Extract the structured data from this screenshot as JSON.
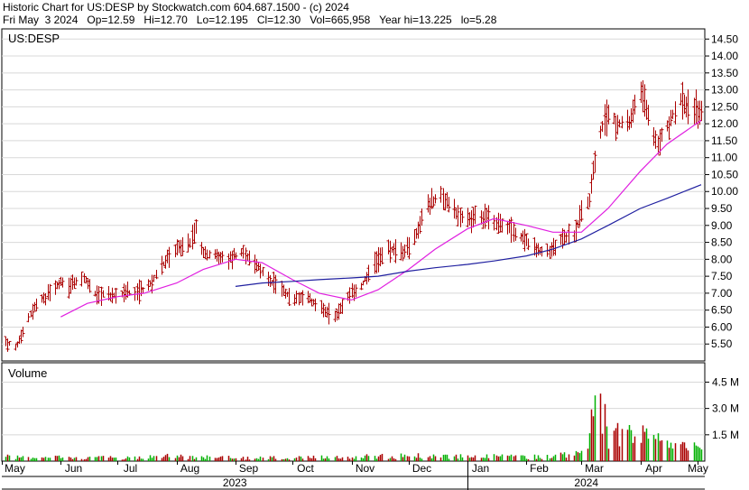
{
  "header": {
    "line1": "Historic Chart for US:DESP by Stockwatch.com 604.687.1500 - (c) 2024",
    "line2": "Fri May  3 2024   Op=12.59   Hi=12.70   Lo=12.195   Cl=12.30   Vol=665,958   Year hi=13.225   lo=5.28"
  },
  "chart_data": {
    "type": "ohlc-bar",
    "symbol": "US:DESP",
    "price_axis": {
      "min": 5.0,
      "max": 14.8,
      "ticks": [
        "5.50",
        "6.00",
        "6.50",
        "7.00",
        "7.50",
        "8.00",
        "8.50",
        "9.00",
        "9.50",
        "10.00",
        "10.50",
        "11.00",
        "11.50",
        "12.00",
        "12.50",
        "13.00",
        "13.50",
        "14.00",
        "14.50"
      ]
    },
    "volume_panel": {
      "label": "Volume",
      "max_m": 5.5,
      "ticks": [
        "1.5 M",
        "3.0 M",
        "4.5 M"
      ]
    },
    "months": [
      "May",
      "Jun",
      "Jul",
      "Aug",
      "Sep",
      "Oct",
      "Nov",
      "Dec",
      "Jan",
      "Feb",
      "Mar",
      "Apr",
      "May"
    ],
    "years": [
      "2023",
      "2024"
    ],
    "price_anchors": [
      [
        "2023-05-03",
        5.6
      ],
      [
        "2023-05-08",
        5.4
      ],
      [
        "2023-05-12",
        5.9
      ],
      [
        "2023-05-18",
        6.6
      ],
      [
        "2023-05-24",
        6.9
      ],
      [
        "2023-06-01",
        7.3
      ],
      [
        "2023-06-06",
        7.2
      ],
      [
        "2023-06-12",
        7.5
      ],
      [
        "2023-06-19",
        7.0
      ],
      [
        "2023-06-26",
        6.9
      ],
      [
        "2023-07-03",
        7.0
      ],
      [
        "2023-07-10",
        7.0
      ],
      [
        "2023-07-17",
        7.2
      ],
      [
        "2023-07-24",
        7.8
      ],
      [
        "2023-07-31",
        8.3
      ],
      [
        "2023-08-07",
        8.4
      ],
      [
        "2023-08-11",
        8.9
      ],
      [
        "2023-08-15",
        8.2
      ],
      [
        "2023-08-21",
        8.1
      ],
      [
        "2023-08-28",
        8.0
      ],
      [
        "2023-09-05",
        8.2
      ],
      [
        "2023-09-11",
        7.9
      ],
      [
        "2023-09-18",
        7.4
      ],
      [
        "2023-09-25",
        7.1
      ],
      [
        "2023-10-02",
        6.8
      ],
      [
        "2023-10-09",
        6.9
      ],
      [
        "2023-10-16",
        6.5
      ],
      [
        "2023-10-23",
        6.3
      ],
      [
        "2023-10-30",
        6.9
      ],
      [
        "2023-11-06",
        7.2
      ],
      [
        "2023-11-13",
        7.9
      ],
      [
        "2023-11-20",
        8.3
      ],
      [
        "2023-11-27",
        8.2
      ],
      [
        "2023-12-04",
        8.6
      ],
      [
        "2023-12-11",
        9.6
      ],
      [
        "2023-12-18",
        9.9
      ],
      [
        "2023-12-25",
        9.4
      ],
      [
        "2024-01-02",
        9.2
      ],
      [
        "2024-01-08",
        9.3
      ],
      [
        "2024-01-15",
        9.1
      ],
      [
        "2024-01-22",
        9.0
      ],
      [
        "2024-01-29",
        8.7
      ],
      [
        "2024-02-05",
        8.3
      ],
      [
        "2024-02-12",
        8.2
      ],
      [
        "2024-02-19",
        8.6
      ],
      [
        "2024-02-26",
        8.7
      ],
      [
        "2024-03-01",
        9.4
      ],
      [
        "2024-03-05",
        9.8
      ],
      [
        "2024-03-08",
        11.0
      ],
      [
        "2024-03-11",
        11.8
      ],
      [
        "2024-03-15",
        12.3
      ],
      [
        "2024-03-20",
        12.0
      ],
      [
        "2024-03-26",
        12.1
      ],
      [
        "2024-04-01",
        12.9
      ],
      [
        "2024-04-05",
        12.2
      ],
      [
        "2024-04-10",
        11.4
      ],
      [
        "2024-04-16",
        12.0
      ],
      [
        "2024-04-22",
        12.7
      ],
      [
        "2024-04-26",
        12.5
      ],
      [
        "2024-05-03",
        12.3
      ]
    ],
    "sma_short": [
      [
        "2023-06-01",
        6.3
      ],
      [
        "2023-06-15",
        6.7
      ],
      [
        "2023-07-01",
        6.9
      ],
      [
        "2023-07-15",
        7.0
      ],
      [
        "2023-08-01",
        7.3
      ],
      [
        "2023-08-15",
        7.7
      ],
      [
        "2023-09-01",
        8.0
      ],
      [
        "2023-09-15",
        7.9
      ],
      [
        "2023-10-01",
        7.4
      ],
      [
        "2023-10-15",
        7.0
      ],
      [
        "2023-11-01",
        6.8
      ],
      [
        "2023-11-15",
        7.1
      ],
      [
        "2023-12-01",
        7.7
      ],
      [
        "2023-12-15",
        8.3
      ],
      [
        "2024-01-01",
        8.9
      ],
      [
        "2024-01-15",
        9.2
      ],
      [
        "2024-02-01",
        9.0
      ],
      [
        "2024-02-15",
        8.8
      ],
      [
        "2024-03-01",
        8.8
      ],
      [
        "2024-03-15",
        9.5
      ],
      [
        "2024-04-01",
        10.6
      ],
      [
        "2024-04-15",
        11.4
      ],
      [
        "2024-05-03",
        12.1
      ]
    ],
    "sma_long": [
      [
        "2023-09-01",
        7.2
      ],
      [
        "2023-09-15",
        7.3
      ],
      [
        "2023-10-01",
        7.35
      ],
      [
        "2023-10-15",
        7.4
      ],
      [
        "2023-11-01",
        7.45
      ],
      [
        "2023-11-15",
        7.5
      ],
      [
        "2023-12-01",
        7.65
      ],
      [
        "2023-12-15",
        7.75
      ],
      [
        "2024-01-01",
        7.85
      ],
      [
        "2024-01-15",
        7.95
      ],
      [
        "2024-02-01",
        8.1
      ],
      [
        "2024-02-15",
        8.3
      ],
      [
        "2024-03-01",
        8.6
      ],
      [
        "2024-03-15",
        9.0
      ],
      [
        "2024-04-01",
        9.5
      ],
      [
        "2024-04-15",
        9.8
      ],
      [
        "2024-05-03",
        10.2
      ]
    ],
    "volume_anchors_m": [
      [
        "2023-05-03",
        0.25
      ],
      [
        "2023-07-01",
        0.2
      ],
      [
        "2023-08-01",
        0.3
      ],
      [
        "2023-09-01",
        0.2
      ],
      [
        "2023-10-01",
        0.2
      ],
      [
        "2023-11-01",
        0.25
      ],
      [
        "2023-12-01",
        0.3
      ],
      [
        "2024-01-01",
        0.3
      ],
      [
        "2024-02-01",
        0.25
      ],
      [
        "2024-03-01",
        0.4
      ],
      [
        "2024-03-06",
        2.0
      ],
      [
        "2024-03-11",
        4.2
      ],
      [
        "2024-03-15",
        1.6
      ],
      [
        "2024-04-01",
        1.4
      ],
      [
        "2024-04-15",
        0.9
      ],
      [
        "2024-05-03",
        0.7
      ]
    ],
    "colors": {
      "bar": "#aa0000",
      "volume": "#00b000",
      "sma_short": "#e020e0",
      "sma_long": "#2020a0",
      "grid": "#d8d8d8"
    }
  }
}
